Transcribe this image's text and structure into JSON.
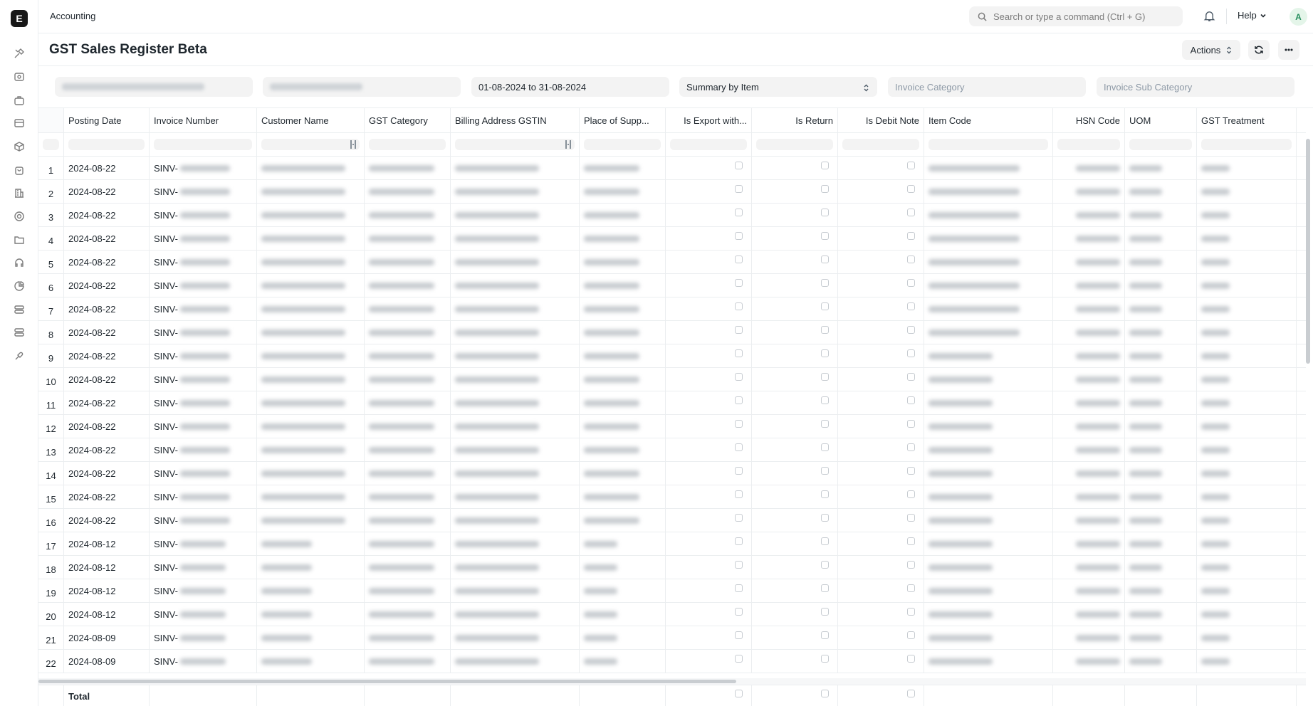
{
  "topbar": {
    "breadcrumb": "Accounting",
    "search_placeholder": "Search or type a command (Ctrl + G)",
    "help_label": "Help",
    "avatar_letter": "A"
  },
  "rail": {
    "logo_letter": "E"
  },
  "page": {
    "title": "GST Sales Register Beta",
    "actions_label": "Actions"
  },
  "filters": {
    "date_range": "01-08-2024 to 31-08-2024",
    "summary_by": "Summary by Item",
    "invoice_category_placeholder": "Invoice Category",
    "invoice_sub_category_placeholder": "Invoice Sub Category"
  },
  "table": {
    "columns": [
      "Posting Date",
      "Invoice Number",
      "Customer Name",
      "GST Category",
      "Billing Address GSTIN",
      "Place of Supp...",
      "Is Export with...",
      "Is Return",
      "Is Debit Note",
      "Item Code",
      "HSN Code",
      "UOM",
      "GST Treatment"
    ],
    "rows": [
      {
        "n": "1",
        "date": "2024-08-22",
        "inv": "SINV-"
      },
      {
        "n": "2",
        "date": "2024-08-22",
        "inv": "SINV-"
      },
      {
        "n": "3",
        "date": "2024-08-22",
        "inv": "SINV-"
      },
      {
        "n": "4",
        "date": "2024-08-22",
        "inv": "SINV-"
      },
      {
        "n": "5",
        "date": "2024-08-22",
        "inv": "SINV-"
      },
      {
        "n": "6",
        "date": "2024-08-22",
        "inv": "SINV-"
      },
      {
        "n": "7",
        "date": "2024-08-22",
        "inv": "SINV-"
      },
      {
        "n": "8",
        "date": "2024-08-22",
        "inv": "SINV-"
      },
      {
        "n": "9",
        "date": "2024-08-22",
        "inv": "SINV-"
      },
      {
        "n": "10",
        "date": "2024-08-22",
        "inv": "SINV-"
      },
      {
        "n": "11",
        "date": "2024-08-22",
        "inv": "SINV-"
      },
      {
        "n": "12",
        "date": "2024-08-22",
        "inv": "SINV-"
      },
      {
        "n": "13",
        "date": "2024-08-22",
        "inv": "SINV-"
      },
      {
        "n": "14",
        "date": "2024-08-22",
        "inv": "SINV-"
      },
      {
        "n": "15",
        "date": "2024-08-22",
        "inv": "SINV-"
      },
      {
        "n": "16",
        "date": "2024-08-22",
        "inv": "SINV-"
      },
      {
        "n": "17",
        "date": "2024-08-12",
        "inv": "SINV-"
      },
      {
        "n": "18",
        "date": "2024-08-12",
        "inv": "SINV-"
      },
      {
        "n": "19",
        "date": "2024-08-12",
        "inv": "SINV-"
      },
      {
        "n": "20",
        "date": "2024-08-12",
        "inv": "SINV-"
      },
      {
        "n": "21",
        "date": "2024-08-09",
        "inv": "SINV-"
      },
      {
        "n": "22",
        "date": "2024-08-09",
        "inv": "SINV-"
      }
    ],
    "total_label": "Total"
  },
  "icons": [
    "tools-icon",
    "eye-icon",
    "briefcase-icon",
    "card-icon",
    "package-icon",
    "bag-icon",
    "building-icon",
    "shield-icon",
    "folder-icon",
    "headset-icon",
    "chart-icon",
    "server-icon",
    "server-icon",
    "link-icon"
  ]
}
